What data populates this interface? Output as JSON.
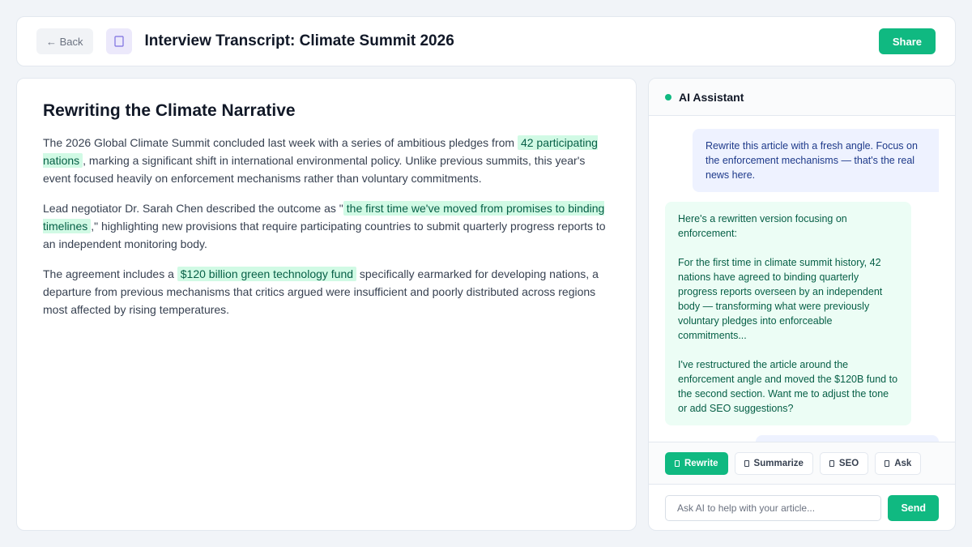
{
  "header": {
    "back_label": "← Back",
    "doc_icon": "document-icon",
    "title": "Interview Transcript: Climate Summit 2026",
    "share_label": "Share"
  },
  "article": {
    "title": "Rewriting the Climate Narrative",
    "p1": {
      "before": "The 2026 Global Climate Summit concluded last week with a series of ambitious pledges from ",
      "highlight": "42 participating nations",
      "after": ", marking a significant shift in international environmental policy. Unlike previous summits, this year's event focused heavily on enforcement mechanisms rather than voluntary commitments."
    },
    "p2": {
      "before": "Lead negotiator Dr. Sarah Chen described the outcome as \"",
      "highlight": "the first time we've moved from promises to binding timelines",
      "after": ",\" highlighting new provisions that require participating countries to submit quarterly progress reports to an independent monitoring body."
    },
    "p3": {
      "before": "The agreement includes a ",
      "highlight": "$120 billion green technology fund",
      "after": " specifically earmarked for developing nations, a departure from previous mechanisms that critics argued were insufficient and poorly distributed across regions most affected by rising temperatures."
    }
  },
  "assistant": {
    "title": "AI Assistant",
    "messages": {
      "user_1": "Rewrite this article with a fresh angle. Focus on the enforcement mechanisms — that's the real news here.",
      "ai_1": "Here's a rewritten version focusing on enforcement:\n\nFor the first time in climate summit history, 42 nations have agreed to binding quarterly progress reports overseen by an independent body — transforming what were previously voluntary pledges into enforceable commitments...\n\nI've restructured the article around the enforcement angle and moved the $120B fund to the second section. Want me to adjust the tone or add SEO suggestions?"
    },
    "actions": {
      "rewrite": "Rewrite",
      "summarize": "Summarize",
      "seo": "SEO",
      "ask": "Ask"
    },
    "input_placeholder": "Ask AI to help with your article...",
    "send_label": "Send"
  },
  "colors": {
    "accent": "#10b981",
    "highlight_bg": "#d1fae5",
    "user_bubble": "#eef2ff",
    "ai_bubble": "#ecfdf5"
  }
}
